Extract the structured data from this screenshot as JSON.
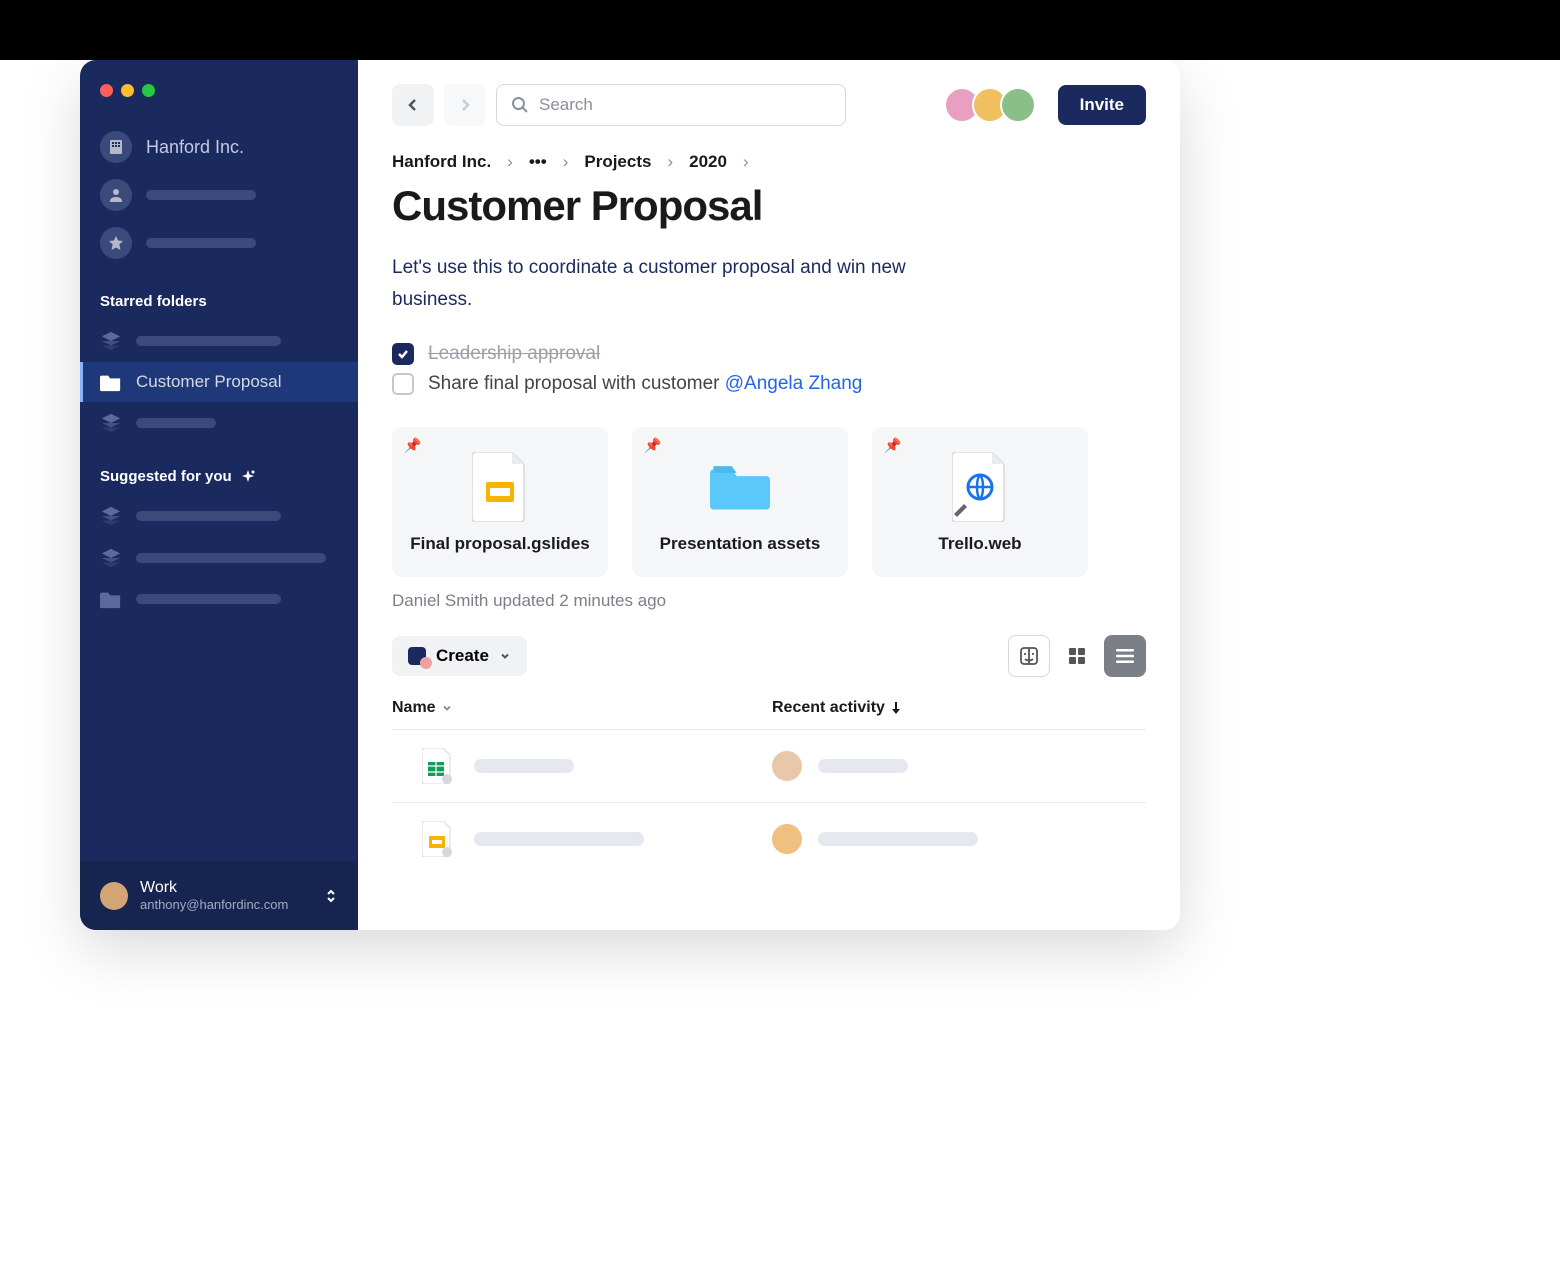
{
  "sidebar": {
    "org_name": "Hanford Inc.",
    "starred_header": "Starred folders",
    "suggested_header": "Suggested for you",
    "active_folder": "Customer Proposal"
  },
  "account": {
    "name": "Work",
    "email": "anthony@hanfordinc.com"
  },
  "topbar": {
    "search_placeholder": "Search",
    "invite_label": "Invite"
  },
  "breadcrumb": {
    "items": [
      "Hanford Inc.",
      "•••",
      "Projects",
      "2020"
    ]
  },
  "page": {
    "title": "Customer Proposal",
    "description": "Let's use this to coordinate a customer proposal and win new business."
  },
  "tasks": [
    {
      "text": "Leadership approval",
      "done": true
    },
    {
      "text": "Share final proposal with customer ",
      "mention": "@Angela Zhang",
      "done": false
    }
  ],
  "cards": [
    {
      "label": "Final proposal.gslides"
    },
    {
      "label": "Presentation assets"
    },
    {
      "label": "Trello.web"
    }
  ],
  "status": "Daniel Smith updated 2 minutes ago",
  "toolbar": {
    "create_label": "Create"
  },
  "columns": {
    "name": "Name",
    "activity": "Recent activity"
  }
}
